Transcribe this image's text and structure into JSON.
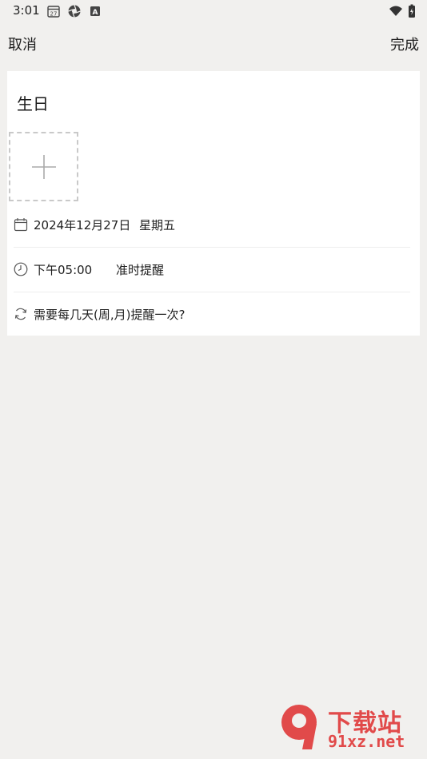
{
  "status_bar": {
    "time": "3:01",
    "left_icons": [
      "calendar-27-icon",
      "shutter-icon",
      "font-a-icon"
    ],
    "right_icons": [
      "wifi-icon",
      "battery-charging-icon"
    ]
  },
  "topbar": {
    "cancel_label": "取消",
    "done_label": "完成"
  },
  "event": {
    "title": "生日",
    "date": "2024年12月27日",
    "weekday": "星期五",
    "time": "下午05:00",
    "reminder": "准时提醒",
    "repeat_prompt": "需要每几天(周,月)提醒一次?"
  },
  "watermark": {
    "brand": "下载站",
    "url": "91xz.net",
    "logo_text": "9"
  },
  "colors": {
    "background": "#f1f0ee",
    "card": "#ffffff",
    "watermark": "#e14a4a"
  }
}
